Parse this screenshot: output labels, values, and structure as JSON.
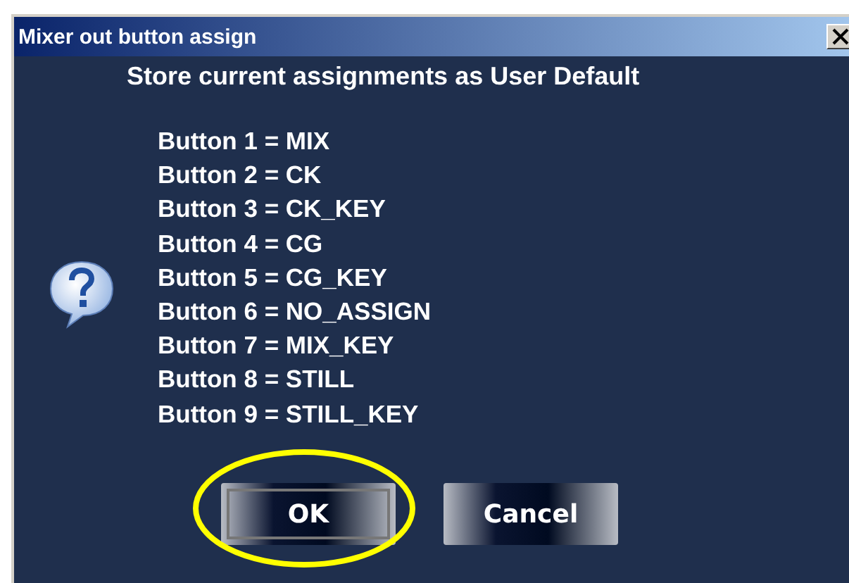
{
  "window": {
    "title": "Mixer out button assign"
  },
  "heading": "Store current assignments as User Default",
  "assignments": [
    "Button 1 = MIX",
    "Button 2 = CK",
    "Button 3 = CK_KEY",
    "Button 4 = CG",
    "Button 5 = CG_KEY",
    "Button 6 = NO_ASSIGN",
    "Button 7 = MIX_KEY",
    "Button 8 = STILL",
    "Button 9 = STILL_KEY"
  ],
  "buttons": [
    {
      "label": "OK",
      "focused": true,
      "highlighted": true
    },
    {
      "label": "Cancel",
      "focused": false,
      "highlighted": false
    }
  ]
}
